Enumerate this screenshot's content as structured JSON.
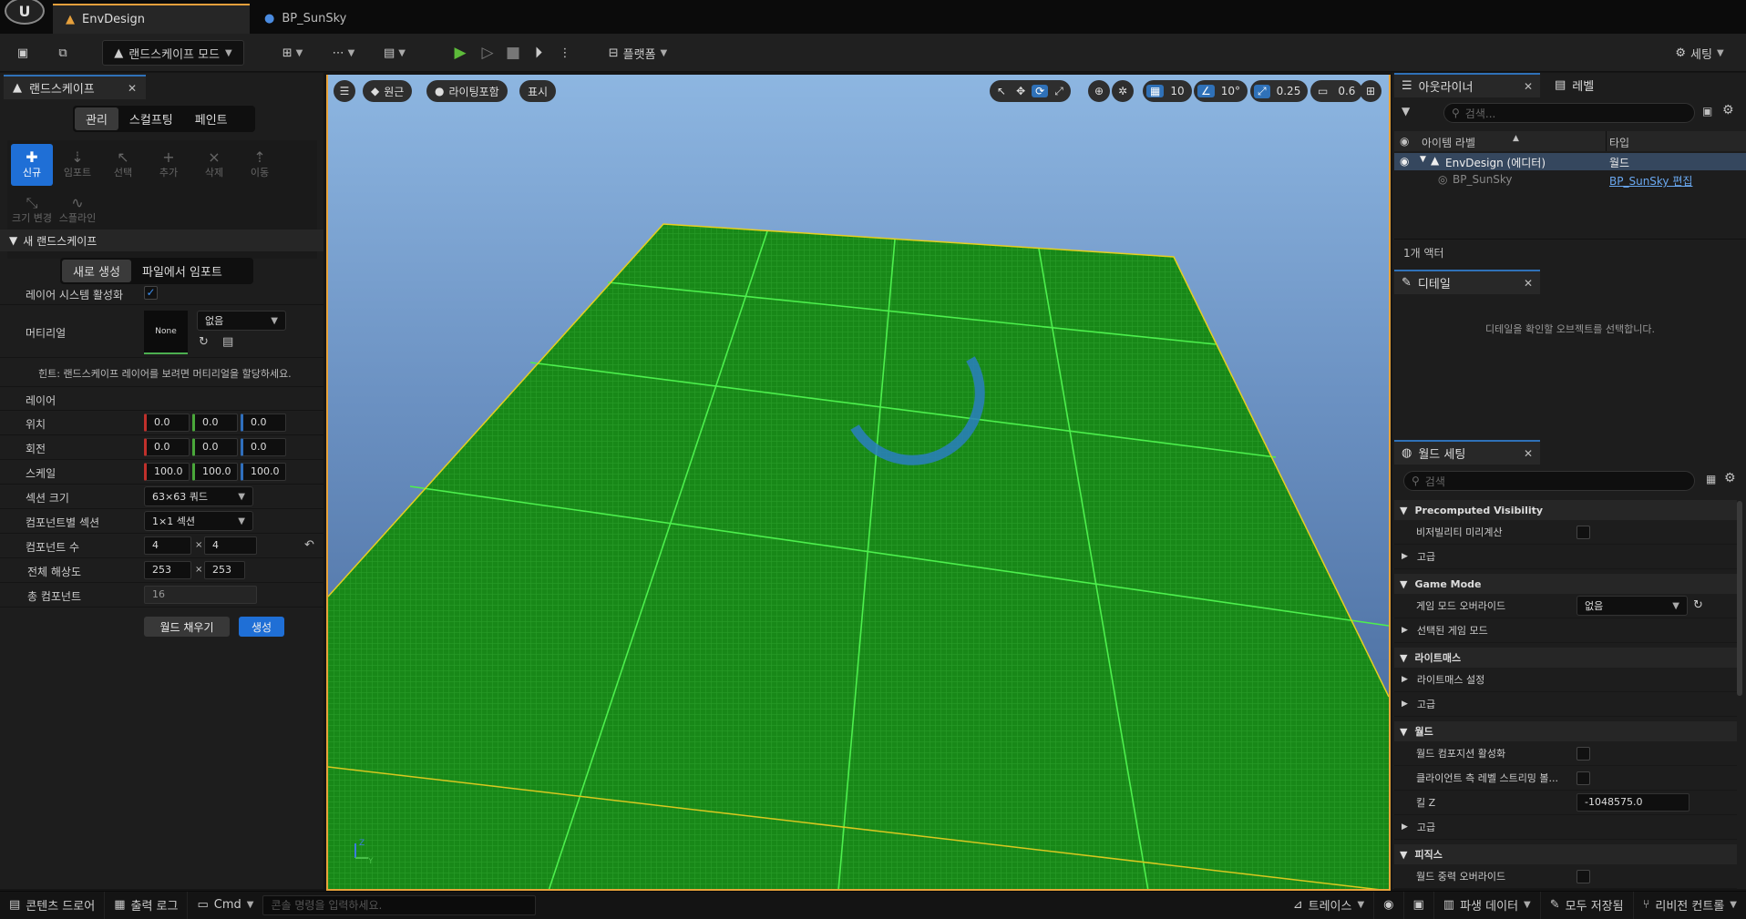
{
  "window": {
    "tabs": [
      "EnvDesign",
      "BP_SunSky"
    ]
  },
  "toolbar": {
    "mode": "랜드스케이프 모드",
    "platforms": "플랫폼",
    "settings": "세팅"
  },
  "landscape_panel": {
    "title": "랜드스케이프",
    "mode_tabs": [
      "관리",
      "스컬프팅",
      "페인트"
    ],
    "tools": [
      {
        "label": "신규",
        "icon": "new-icon"
      },
      {
        "label": "임포트",
        "icon": "import-icon"
      },
      {
        "label": "선택",
        "icon": "select-icon"
      },
      {
        "label": "추가",
        "icon": "add-icon"
      },
      {
        "label": "삭제",
        "icon": "delete-icon"
      },
      {
        "label": "이동",
        "icon": "move-icon"
      },
      {
        "label": "크기 변경",
        "icon": "resize-icon"
      },
      {
        "label": "스플라인",
        "icon": "spline-icon"
      }
    ],
    "section": "새 랜드스케이프",
    "create_tabs": [
      "새로 생성",
      "파일에서 임포트"
    ],
    "layer_system_label": "레이어 시스템 활성화",
    "material_label": "머티리얼",
    "material_thumb": "None",
    "material_value": "없음",
    "hint": "힌트: 랜드스케이프 레이어를 보려면 머티리얼을 할당하세요.",
    "layers_label": "레이어",
    "location_label": "위치",
    "location": [
      "0.0",
      "0.0",
      "0.0"
    ],
    "rotation_label": "회전",
    "rotation": [
      "0.0",
      "0.0",
      "0.0"
    ],
    "scale_label": "스케일",
    "scale": [
      "100.0",
      "100.0",
      "100.0"
    ],
    "section_size_label": "섹션 크기",
    "section_size": "63×63 쿼드",
    "sections_per_component_label": "컴포넌트별 섹션",
    "sections_per_component": "1×1 섹션",
    "component_count_label": "컴포넌트 수",
    "component_count": [
      "4",
      "4"
    ],
    "resolution_label": "전체 해상도",
    "resolution": [
      "253",
      "253"
    ],
    "total_components_label": "총 컴포넌트",
    "total_components": "16",
    "fill_world_button": "월드 채우기",
    "create_button": "생성"
  },
  "viewport": {
    "perspective": "원근",
    "lit": "라이팅포함",
    "show": "표시",
    "grid_snap": "10",
    "rotation_snap": "10°",
    "scale_snap": "0.25",
    "camera_speed": "0.6"
  },
  "outliner": {
    "title": "아웃라이너",
    "levels_tab": "레벨",
    "search_placeholder": "검색...",
    "col_label": "아이템 라벨",
    "col_type": "타입",
    "rows": [
      {
        "name": "EnvDesign (에디터)",
        "type": "월드"
      },
      {
        "name": "BP_SunSky",
        "type": "BP_SunSky 편집"
      }
    ],
    "count": "1개 액터"
  },
  "details": {
    "title": "디테일",
    "empty": "디테일을 확인할 오브젝트를 선택합니다."
  },
  "world_settings": {
    "title": "월드 세팅",
    "search_placeholder": "검색",
    "precomputed_visibility": "Precomputed Visibility",
    "precompute_visibility": "비저빌리티 미리계산",
    "advanced": "고급",
    "game_mode": "Game Mode",
    "gamemode_override": "게임 모드 오버라이드",
    "gamemode_value": "없음",
    "selected_gamemode": "선택된 게임 모드",
    "lightmass": "라이트매스",
    "lightmass_settings": "라이트매스 설정",
    "world": "월드",
    "enable_world_composition": "월드 컴포지션 활성화",
    "client_side_streaming": "클라이언트 측 레벨 스트리밍 볼...",
    "kill_z": "킬 Z",
    "kill_z_value": "-1048575.0",
    "physics": "피직스",
    "world_gravity_override": "월드 중력 오버라이드"
  },
  "statusbar": {
    "content_drawer": "콘텐츠 드로어",
    "output_log": "출력 로그",
    "cmd": "Cmd",
    "console_placeholder": "콘솔 명령을 입력하세요.",
    "trace": "트레이스",
    "derived_data": "파생 데이터",
    "save_all": "모두 저장됨",
    "revision_control": "리비전 컨트롤"
  }
}
